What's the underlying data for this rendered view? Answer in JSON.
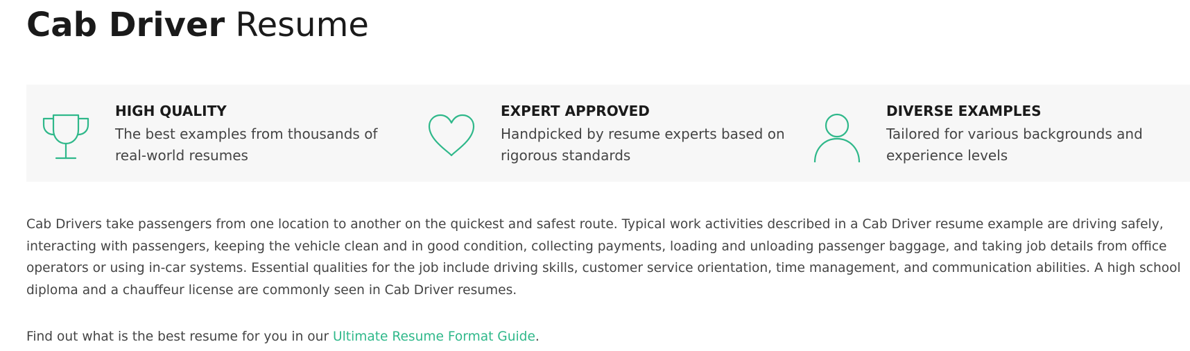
{
  "title": {
    "bold": "Cab Driver",
    "regular": " Resume"
  },
  "features": [
    {
      "icon": "trophy-icon",
      "title": "HIGH QUALITY",
      "description": "The best examples from thousands of real-world resumes"
    },
    {
      "icon": "heart-icon",
      "title": "EXPERT APPROVED",
      "description": "Handpicked by resume experts based on rigorous standards"
    },
    {
      "icon": "person-icon",
      "title": "DIVERSE EXAMPLES",
      "description": "Tailored for various backgrounds and experience levels"
    }
  ],
  "intro": "Cab Drivers take passengers from one location to another on the quickest and safest route. Typical work activities described in a Cab Driver resume example are driving safely, interacting with passengers, keeping the vehicle clean and in good condition, collecting payments, loading and unloading passenger baggage, and taking job details from office operators or using in-car systems. Essential qualities for the job include driving skills, customer service orientation, time management, and communication abilities. A high school diploma and a chauffeur license are commonly seen in Cab Driver resumes.",
  "guide": {
    "prefix": "Find out what is the best resume for you in our ",
    "link_text": "Ultimate Resume Format Guide",
    "suffix": "."
  },
  "colors": {
    "accent": "#2fb88a",
    "panel_bg": "#f7f7f7",
    "text": "#444444",
    "heading": "#1a1a1a"
  }
}
